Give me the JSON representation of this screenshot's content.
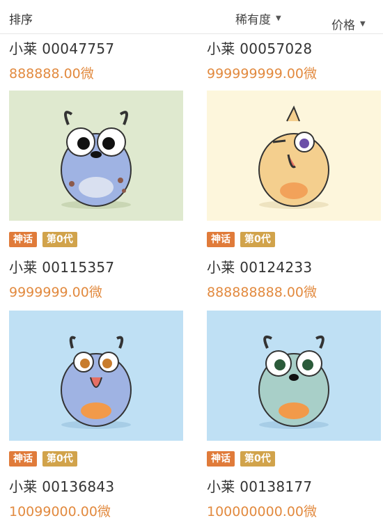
{
  "header": {
    "sort_label": "排序",
    "rarity_label": "稀有度",
    "price_label": "价格"
  },
  "cards": [
    {
      "name": "小莱 00047757",
      "price": "888888.00微",
      "tags": []
    },
    {
      "name": "小莱 00057028",
      "price": "999999999.00微",
      "tags": []
    },
    {
      "name": "小莱 00115357",
      "price": "9999999.00微",
      "tags": [
        "神话",
        "第0代"
      ],
      "bg": "#dfe9cf",
      "body": "#9fb3e3",
      "accent": "#8c5a4b"
    },
    {
      "name": "小莱 00124233",
      "price": "888888888.00微",
      "tags": [
        "神话",
        "第0代"
      ],
      "bg": "#fdf6dc",
      "body": "#f4cf8e",
      "accent": "#f2a25a"
    },
    {
      "name": "小莱 00136843",
      "price": "10099000.00微",
      "tags": [
        "神话",
        "第0代"
      ],
      "bg": "#bfe0f4",
      "body": "#9fb3e3",
      "accent": "#f29a4a"
    },
    {
      "name": "小莱 00138177",
      "price": "100000000.00微",
      "tags": [
        "神话",
        "第0代"
      ],
      "bg": "#bfe0f4",
      "body": "#a8cfc8",
      "accent": "#f29a4a"
    }
  ],
  "icons": {
    "sort_caret": "caret-down-icon"
  }
}
